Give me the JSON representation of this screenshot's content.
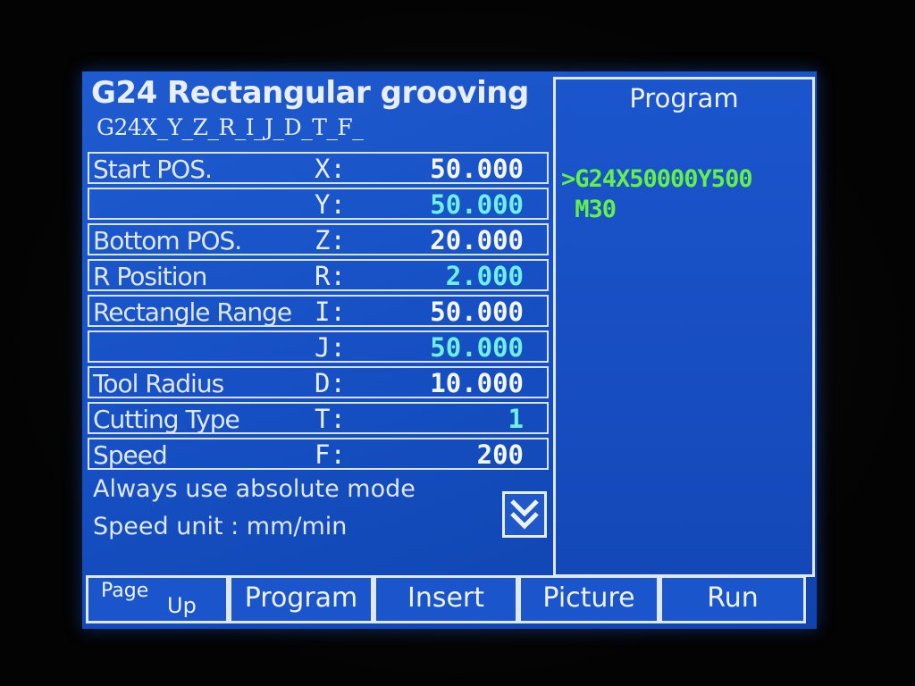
{
  "screen": {
    "title": "G24 Rectangular grooving",
    "syntax": "G24X_Y_Z_R_I_J_D_T_F_"
  },
  "params": [
    {
      "label": "Start POS.",
      "axis": "X:",
      "value": "50.000"
    },
    {
      "label": "",
      "axis": "Y:",
      "value": "50.000"
    },
    {
      "label": "Bottom POS.",
      "axis": "Z:",
      "value": "20.000"
    },
    {
      "label": "R Position",
      "axis": "R:",
      "value": "2.000"
    },
    {
      "label": "Rectangle Range",
      "axis": "I:",
      "value": "50.000"
    },
    {
      "label": "",
      "axis": "J:",
      "value": "50.000"
    },
    {
      "label": "Tool Radius",
      "axis": "D:",
      "value": "10.000"
    },
    {
      "label": "Cutting Type",
      "axis": "T:",
      "value": "1"
    },
    {
      "label": "Speed",
      "axis": "F:",
      "value": "200"
    }
  ],
  "notes": {
    "line1": "Always use absolute mode",
    "line2": "Speed unit : mm/min"
  },
  "program": {
    "title": "Program",
    "lines": [
      ">G24X50000Y500",
      " M30"
    ]
  },
  "softkeys": {
    "page_up_1": "Page",
    "page_up_2": "Up",
    "program": "Program",
    "insert": "Insert",
    "picture": "Picture",
    "run": "Run"
  },
  "colors": {
    "screen_blue": "#1650c4",
    "value_white": "#f4f7ff",
    "value_cyan": "#6ff0e6",
    "program_green": "#63f04a"
  },
  "icons": {
    "scroll_down": "double-chevron-down-icon"
  }
}
